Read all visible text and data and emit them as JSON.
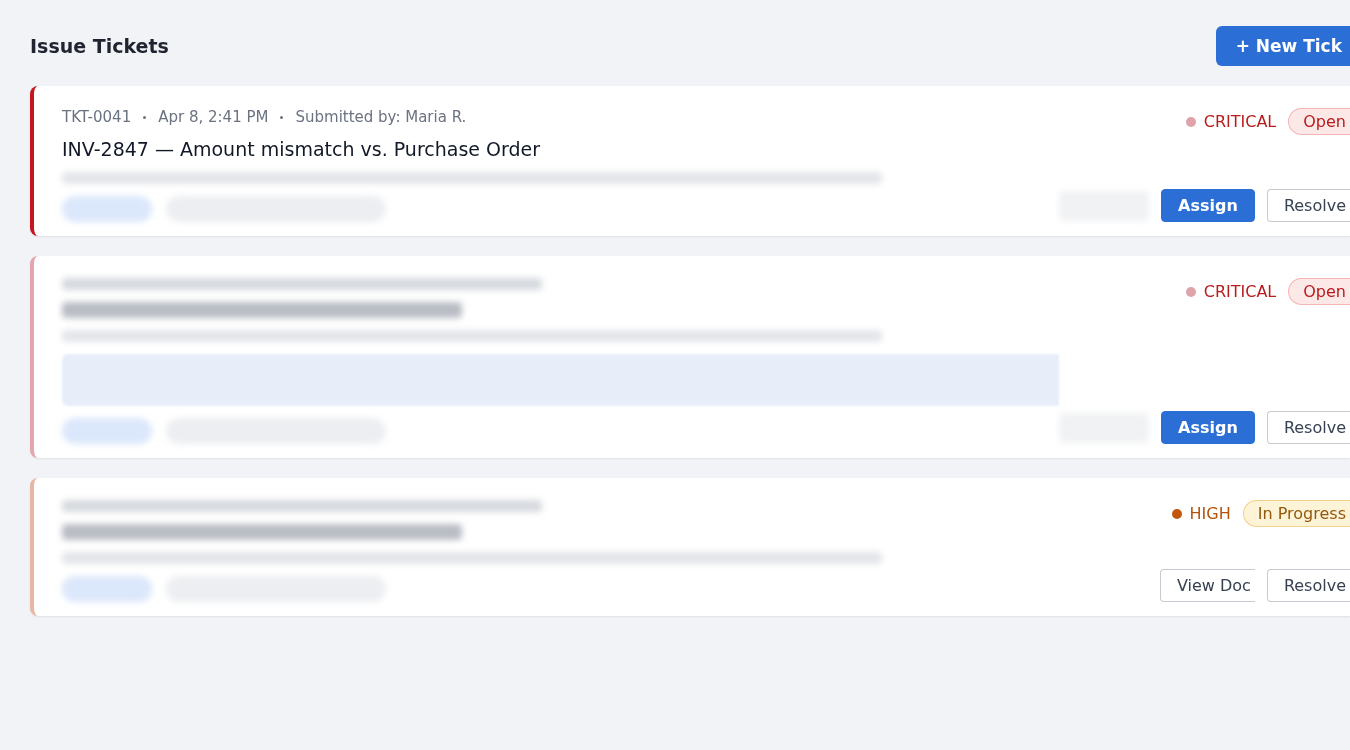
{
  "page": {
    "title": "Issue Tickets",
    "new_button": "+ New Tick"
  },
  "tickets": [
    {
      "meta": [
        "TKT-0041",
        "Apr 8, 2:41 PM",
        "Submitted by: Maria R."
      ],
      "title": "INV-2847 — Amount mismatch vs. Purchase Order",
      "attachment": false,
      "severity": {
        "label": "CRITICAL",
        "kind": "critical",
        "color": "#e0a3aa"
      },
      "status": {
        "label": "Open",
        "kind": "open"
      },
      "actions": [
        {
          "kind": "blurred"
        },
        {
          "label": "Assign",
          "kind": "primary"
        },
        {
          "label": "Resolve",
          "kind": "secondary"
        }
      ]
    },
    {
      "attachment": true,
      "severity": {
        "label": "CRITICAL",
        "kind": "critical",
        "color": "#e0a3aa"
      },
      "status": {
        "label": "Open",
        "kind": "open"
      },
      "actions": [
        {
          "kind": "blurred"
        },
        {
          "label": "Assign",
          "kind": "primary"
        },
        {
          "label": "Resolve",
          "kind": "secondary"
        }
      ]
    },
    {
      "attachment": false,
      "severity": {
        "label": "HIGH",
        "kind": "high",
        "color": "#c2570c"
      },
      "status": {
        "label": "In Progress",
        "kind": "in_progress"
      },
      "actions": [
        {
          "label": "View Doc",
          "kind": "secondary"
        },
        {
          "label": "Resolve",
          "kind": "secondary"
        }
      ]
    }
  ]
}
